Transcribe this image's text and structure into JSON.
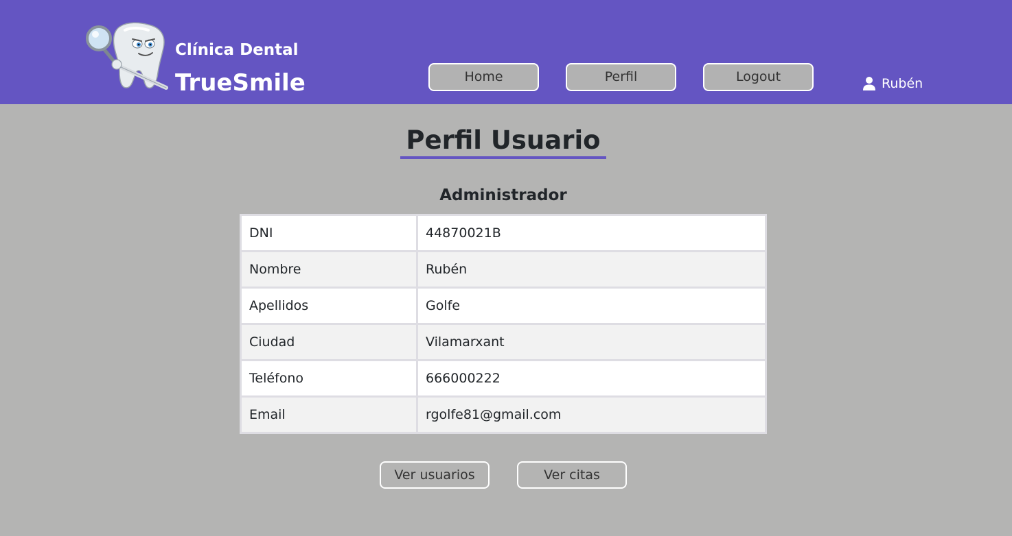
{
  "header": {
    "brand_line1": "Clínica Dental",
    "brand_line2": "TrueSmile",
    "nav": {
      "home_label": "Home",
      "profile_label": "Perfil",
      "logout_label": "Logout"
    },
    "user": {
      "icon": "user-icon",
      "name": "Rubén"
    }
  },
  "main": {
    "title": "Perfil Usuario",
    "role": "Administrador",
    "profile": [
      {
        "label": "DNI",
        "value": "44870021B"
      },
      {
        "label": "Nombre",
        "value": "Rubén"
      },
      {
        "label": "Apellidos",
        "value": "Golfe"
      },
      {
        "label": "Ciudad",
        "value": "Vilamarxant"
      },
      {
        "label": "Teléfono",
        "value": "666000222"
      },
      {
        "label": "Email",
        "value": "rgolfe81@gmail.com"
      }
    ],
    "actions": {
      "view_users_label": "Ver usuarios",
      "view_appointments_label": "Ver citas"
    }
  },
  "colors": {
    "header_bg": "#6455c2",
    "page_bg": "#b4b4b3",
    "nav_button_bg": "#b2b2b2",
    "accent_underline": "#6455c2"
  }
}
